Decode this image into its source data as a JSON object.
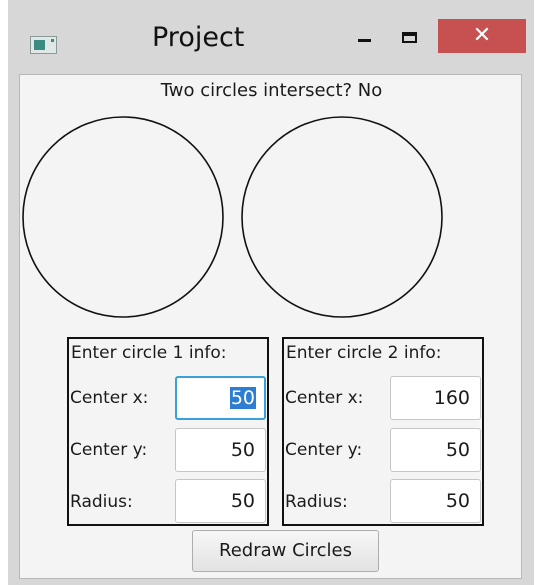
{
  "window": {
    "title": "Project",
    "minimize_label": "minimize",
    "maximize_label": "maximize",
    "close_glyph": "✕",
    "close_color": "#c75050",
    "icon": "app-icon"
  },
  "status": {
    "text": "Two circles intersect? No"
  },
  "circle1": {
    "heading": "Enter circle 1 info:",
    "center_x_label": "Center x:",
    "center_x": "50",
    "center_y_label": "Center y:",
    "center_y": "50",
    "radius_label": "Radius:",
    "radius": "50"
  },
  "circle2": {
    "heading": "Enter circle 2 info:",
    "center_x_label": "Center x:",
    "center_x": "160",
    "center_y_label": "Center y:",
    "center_y": "50",
    "radius_label": "Radius:",
    "radius": "50"
  },
  "actions": {
    "redraw_label": "Redraw Circles"
  },
  "colors": {
    "focus_border": "#39a0da",
    "selection": "#2d7dd2",
    "window_frame": "#d7d7d7",
    "client_bg": "#f4f4f4"
  }
}
